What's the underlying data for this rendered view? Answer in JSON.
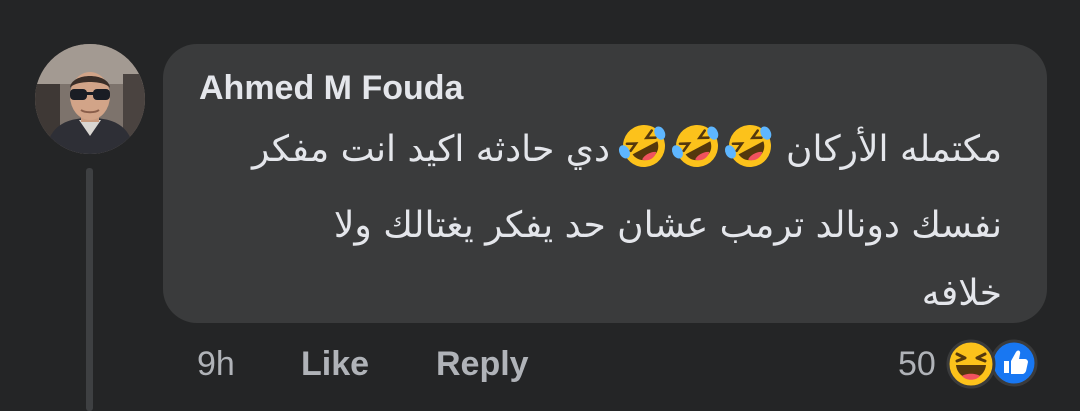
{
  "comment": {
    "author": "Ahmed M Fouda",
    "text_line1_before_emoji": "مكتمله الأركان",
    "text_line1_after_emoji": "دي حادثه اكيد انت مفكر",
    "text_line2": "نفسك دونالد ترمب عشان حد يفكر يغتالك ولا",
    "text_line3": "خلافه",
    "inline_emoji": [
      "rolling-on-floor-laughing",
      "rolling-on-floor-laughing",
      "rolling-on-floor-laughing"
    ]
  },
  "actions": {
    "time": "9h",
    "like_label": "Like",
    "reply_label": "Reply"
  },
  "reactions": {
    "count": "50",
    "icons": [
      "haha",
      "like"
    ]
  },
  "colors": {
    "background": "#242526",
    "bubble": "#3a3b3c",
    "primary_text": "#e4e6eb",
    "secondary_text": "#b0b3b8",
    "like_blue": "#1877f2",
    "emoji_yellow": "#fcc21b"
  }
}
